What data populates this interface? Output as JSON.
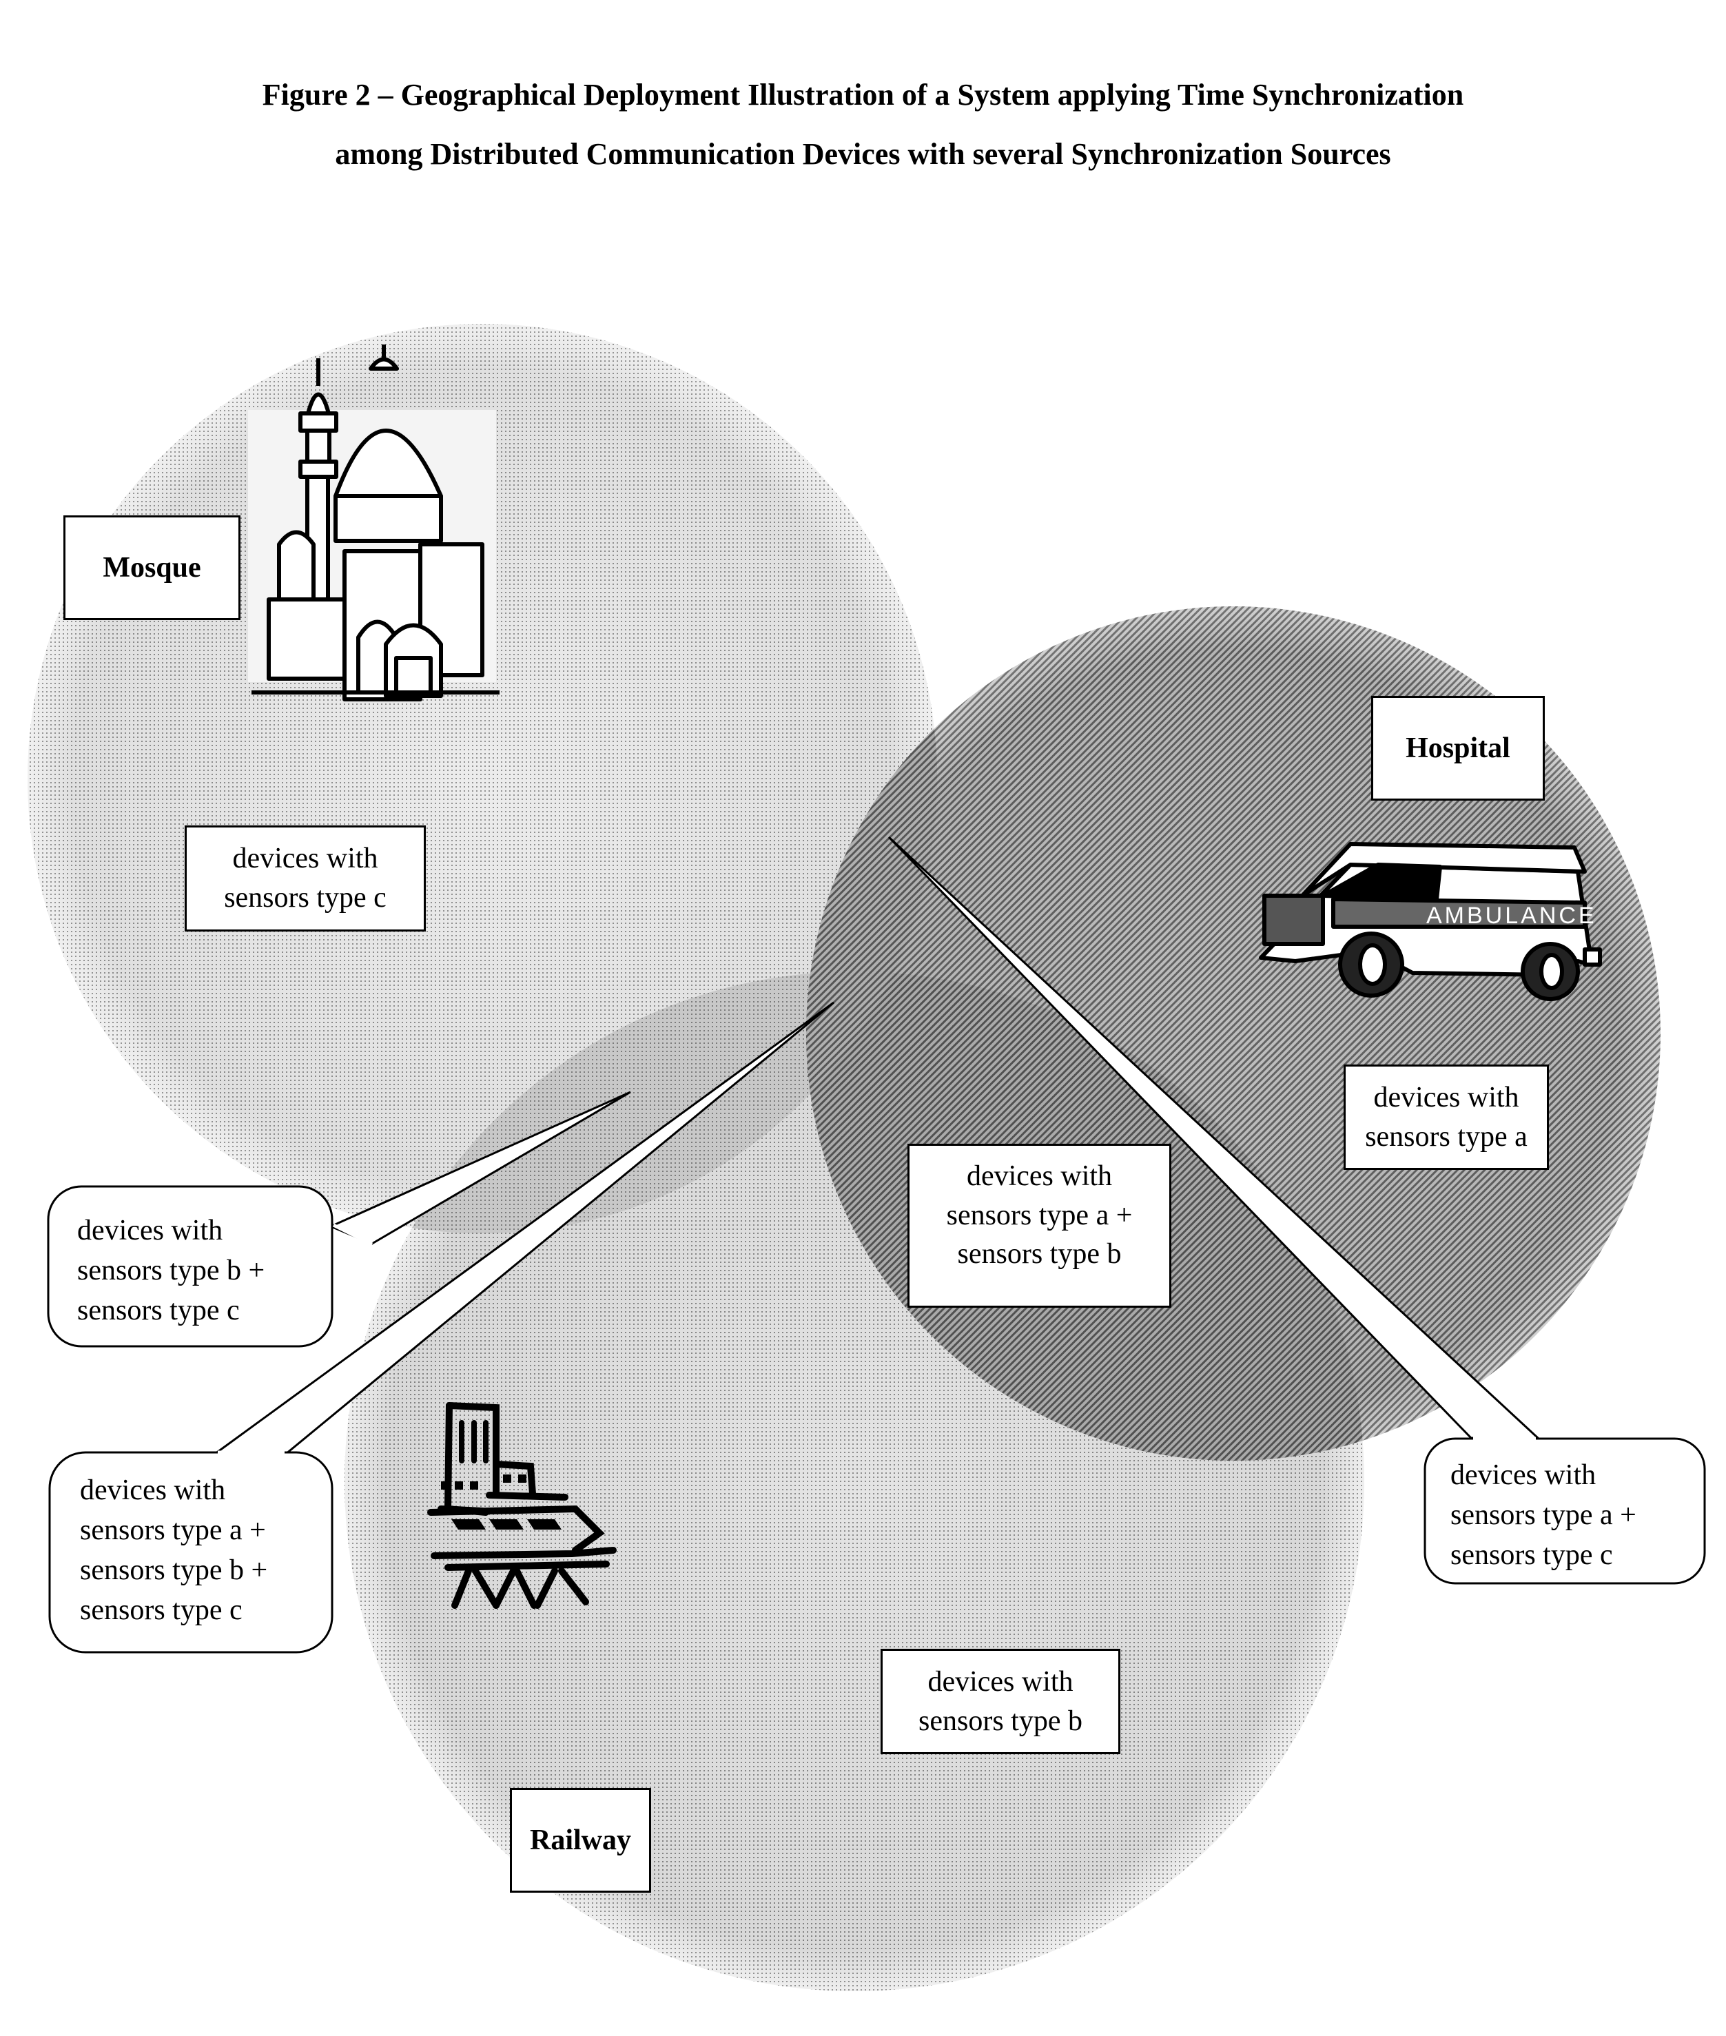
{
  "figure": {
    "title_line1": "Figure 2 – Geographical Deployment Illustration of a System applying Time Synchronization",
    "title_line2": "among Distributed Communication Devices with several Synchronization Sources"
  },
  "zones": [
    {
      "id": "mosque",
      "label": "Mosque",
      "icon": "mosque-icon",
      "devices": "devices with\nsensors type c"
    },
    {
      "id": "hospital",
      "label": "Hospital",
      "icon": "ambulance-icon",
      "icon_text": "AMBULANCE",
      "devices": "devices with\nsensors type a"
    },
    {
      "id": "railway",
      "label": "Railway",
      "icon": "train-station-icon",
      "devices": "devices with\nsensors type b"
    }
  ],
  "overlaps": {
    "hospital_railway": "devices with\nsensors type a +\nsensors type b",
    "mosque_railway": "devices with\nsensors type b +\nsensors type c",
    "all_three": "devices with\nsensors type a +\nsensors type b +\nsensors type c",
    "mosque_hospital": "devices with\nsensors type a +\nsensors type c"
  },
  "colors": {
    "background": "#ffffff",
    "ink": "#000000",
    "zone_fill_light": "#d9d9d9",
    "zone_fill_overlap": "#a8a8a8",
    "zone_fill_dark": "#8a8a8a"
  }
}
